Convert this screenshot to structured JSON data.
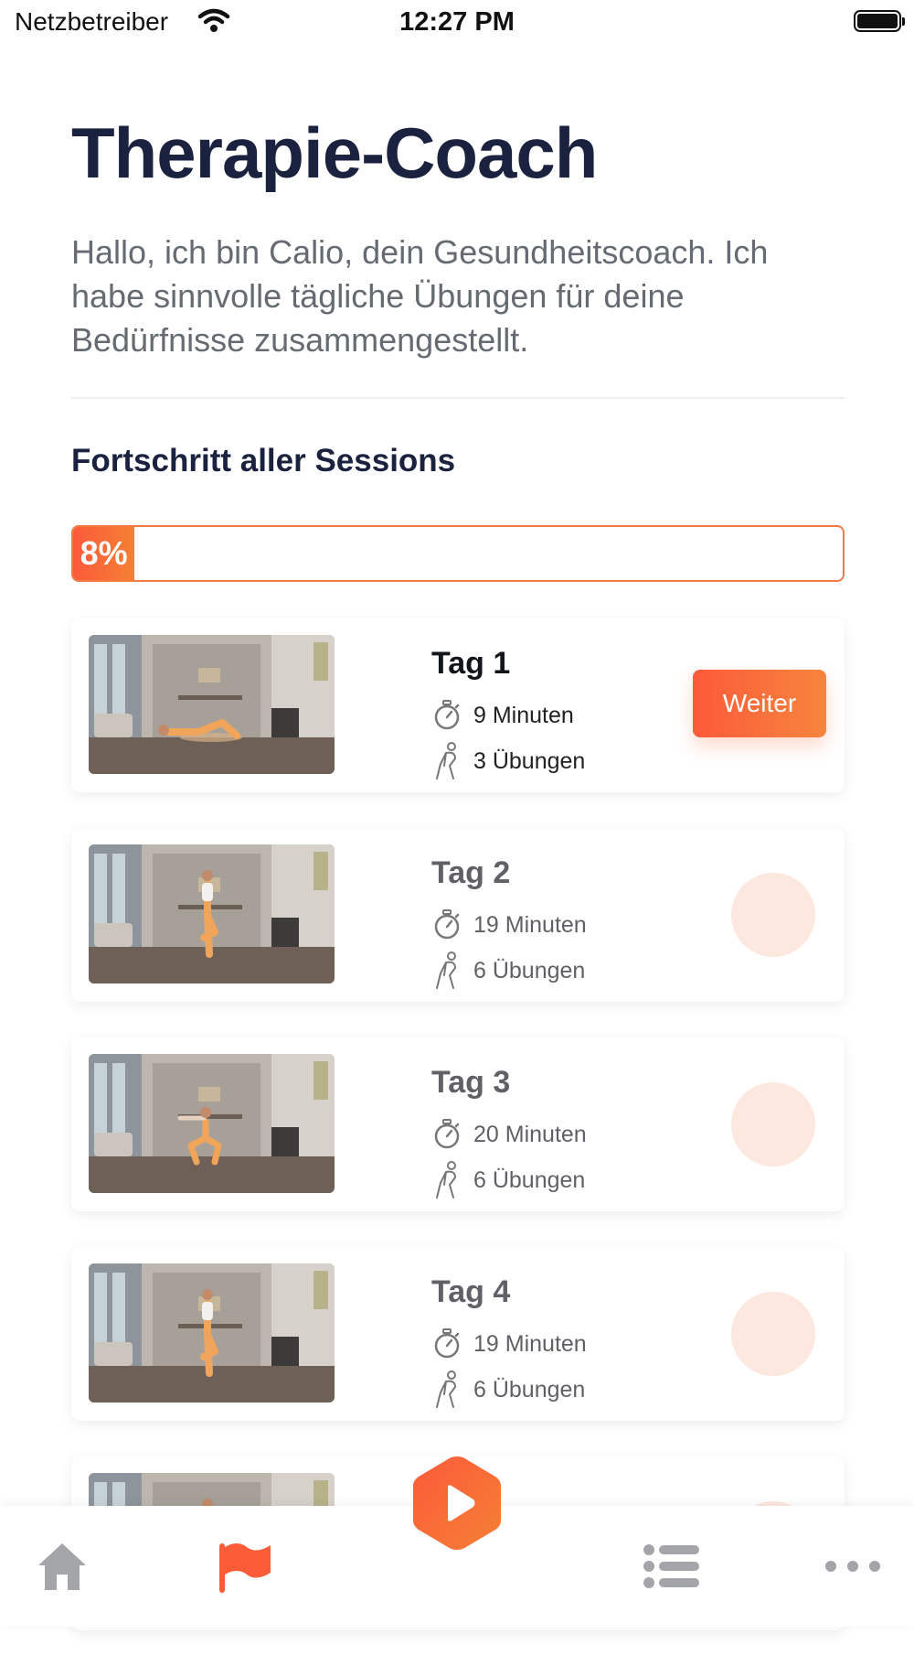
{
  "status_bar": {
    "carrier": "Netzbetreiber",
    "time": "12:27 PM"
  },
  "header": {
    "title": "Therapie-Coach",
    "intro": "Hallo, ich bin Calio, dein Gesundheitscoach. Ich habe sinnvolle tägliche Übungen für deine Bedürfnisse zusammengestellt."
  },
  "progress": {
    "title": "Fortschritt aller Sessions",
    "label": "8%",
    "value_percent": 8
  },
  "sessions": [
    {
      "day": "Tag 1",
      "duration": "9 Minuten",
      "exercises": "3 Übungen",
      "action_label": "Weiter",
      "pose": "lying"
    },
    {
      "day": "Tag 2",
      "duration": "19 Minuten",
      "exercises": "6 Übungen",
      "pose": "standing"
    },
    {
      "day": "Tag 3",
      "duration": "20 Minuten",
      "exercises": "6 Übungen",
      "pose": "squat"
    },
    {
      "day": "Tag 4",
      "duration": "19 Minuten",
      "exercises": "6 Übungen",
      "pose": "standing"
    }
  ],
  "tab_bar": {
    "items": [
      "home-icon",
      "flag-icon",
      "play-icon",
      "list-icon",
      "more-icon"
    ],
    "active": "flag-icon"
  },
  "colors": {
    "accent": "#fc5a3a",
    "accent_end": "#f58034",
    "title": "#1b2240",
    "body_text": "#666a73",
    "locked_circle": "#fde8df"
  }
}
